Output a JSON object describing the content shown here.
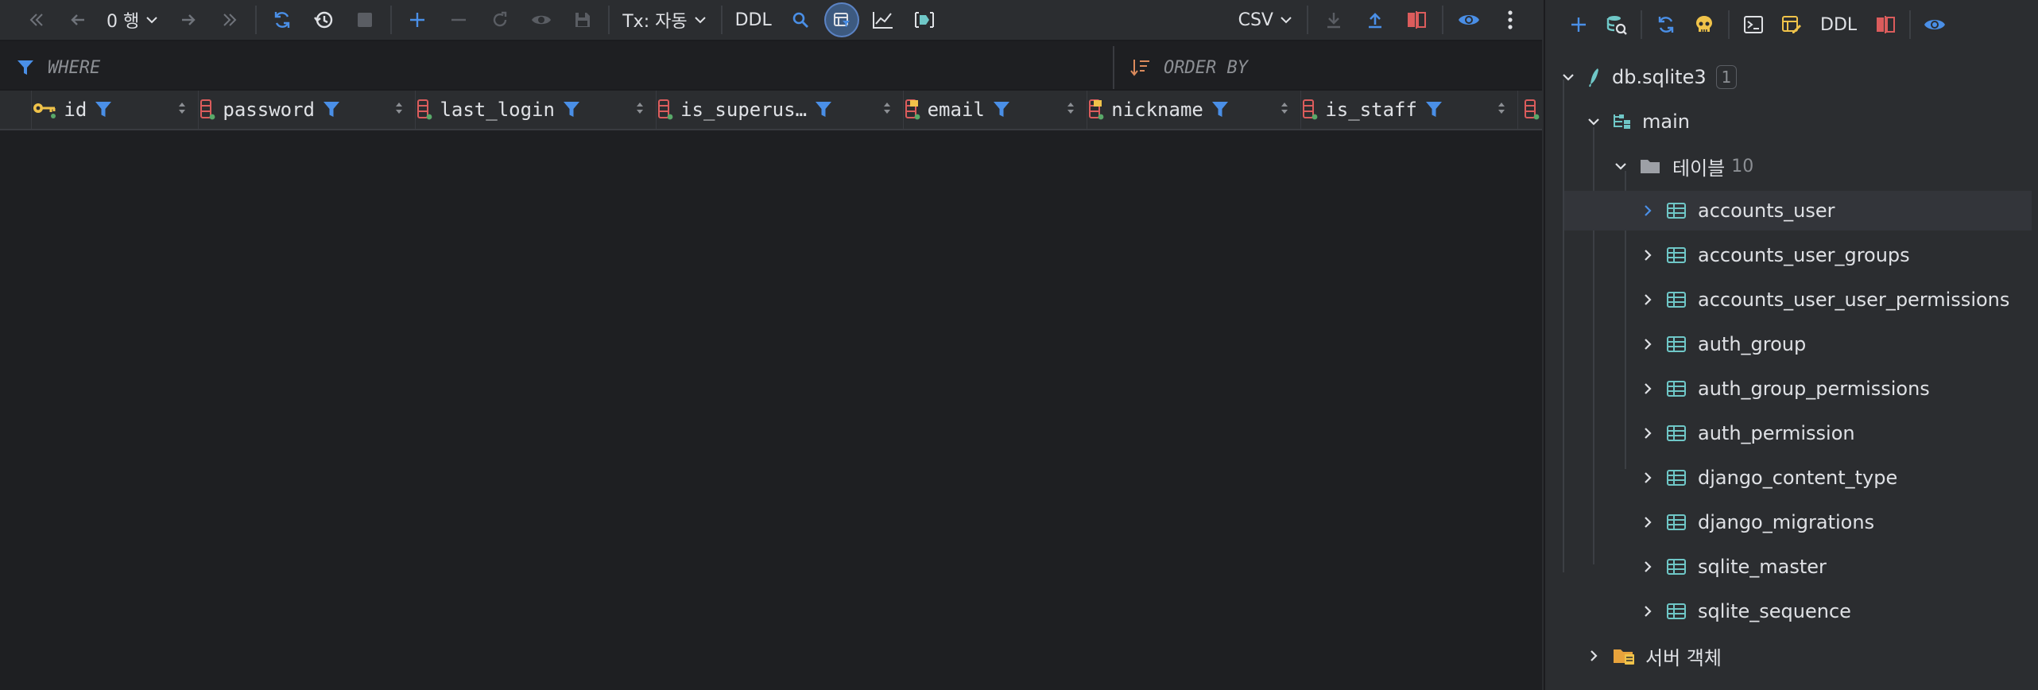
{
  "toolbar": {
    "rows_label": "0 행",
    "tx_label": "Tx: 자동",
    "ddl_label": "DDL",
    "export_format": "CSV"
  },
  "filter": {
    "where_label": "WHERE",
    "order_by_label": "ORDER BY"
  },
  "columns": [
    {
      "name": "id",
      "icon": "primary-key-icon",
      "width": 212
    },
    {
      "name": "password",
      "icon": "column-icon",
      "width": 276
    },
    {
      "name": "last_login",
      "icon": "column-icon",
      "width": 306
    },
    {
      "name": "is_superus…",
      "icon": "column-icon",
      "width": 314
    },
    {
      "name": "email",
      "icon": "index-column-icon",
      "width": 234
    },
    {
      "name": "nickname",
      "icon": "index-column-icon",
      "width": 272
    },
    {
      "name": "is_staff",
      "icon": "column-icon",
      "width": 276
    }
  ],
  "right_toolbar": {
    "ddl_label": "DDL"
  },
  "tree": {
    "database": "db.sqlite3",
    "database_badge": "1",
    "schema": "main",
    "tables_folder": "테이블",
    "tables_count": "10",
    "tables": [
      "accounts_user",
      "accounts_user_groups",
      "accounts_user_user_permissions",
      "auth_group",
      "auth_group_permissions",
      "auth_permission",
      "django_content_type",
      "django_migrations",
      "sqlite_master",
      "sqlite_sequence"
    ],
    "server_objects": "서버 객체"
  },
  "colors": {
    "accent_blue": "#4a8fe7",
    "column_red": "#db5c5c",
    "key_yellow": "#f0c34a",
    "table_teal": "#6fc7c7",
    "folder_orange": "#e8a33c"
  }
}
